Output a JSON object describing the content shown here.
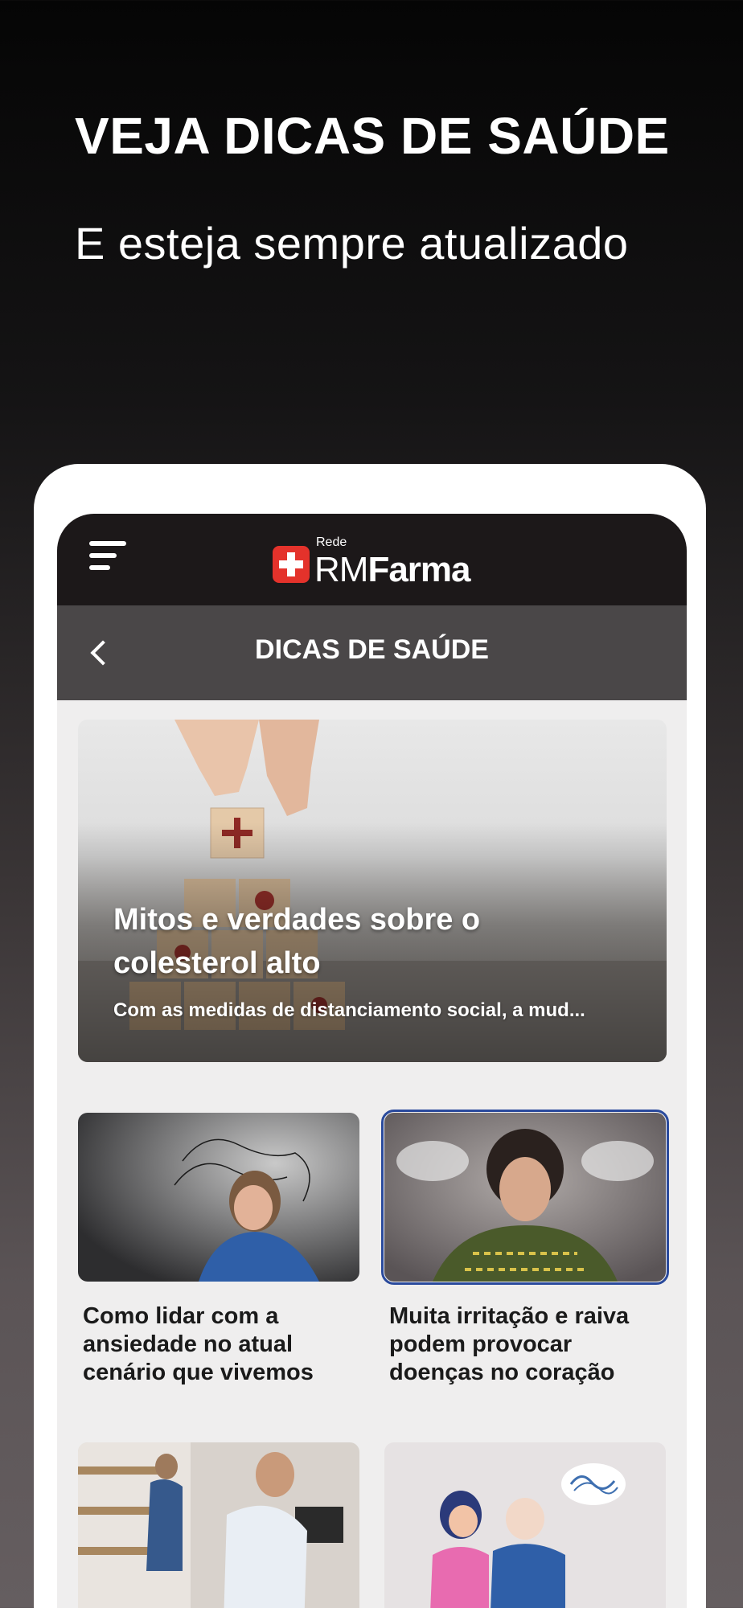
{
  "promo": {
    "title": "VEJA DICAS DE SAÚDE",
    "subtitle": "E esteja sempre atualizado"
  },
  "app": {
    "header": {
      "logo_small": "Rede",
      "logo_rm": "RM",
      "logo_farma": "Farma",
      "menu_icon": "hamburger-menu-icon"
    },
    "subheader": {
      "title": "DICAS DE SAÚDE",
      "back_icon": "chevron-left-icon"
    },
    "featured": {
      "title": "Mitos e verdades sobre o colesterol alto",
      "excerpt": "Com as medidas de distanciamento social, a mud..."
    },
    "articles": [
      {
        "title": "Como lidar com a ansiedade no atual cenário que vivemos"
      },
      {
        "title": "Muita irritação e raiva podem provocar doenças no coração"
      },
      {
        "title": ""
      },
      {
        "title": ""
      }
    ]
  },
  "colors": {
    "header_bg": "#1c1819",
    "subheader_bg": "#4a4748",
    "brand_red": "#e4322b",
    "selected_border": "#2a4a9c"
  }
}
